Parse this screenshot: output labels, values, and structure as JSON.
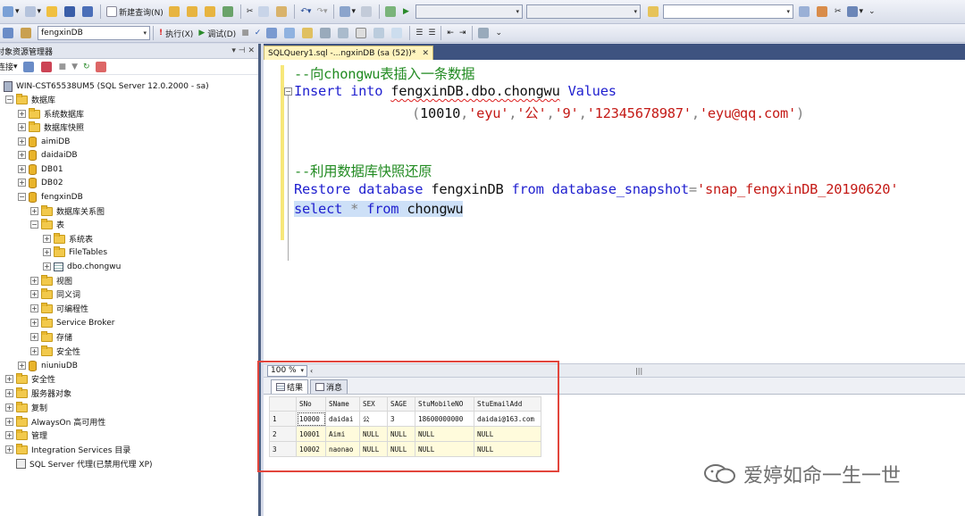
{
  "toolbar1": {
    "new_query_label": "新建查询(N)"
  },
  "toolbar2": {
    "database_selected": "fengxinDB",
    "execute_label": "执行(X)",
    "debug_label": "调试(D)"
  },
  "explorer": {
    "title": "对象资源管理器",
    "connect_label": "连接",
    "server": "WIN-CST65538UM5 (SQL Server 12.0.2000 - sa)",
    "nodes": {
      "databases": "数据库",
      "system_databases": "系统数据库",
      "snapshots": "数据库快照",
      "aimiDB": "aimiDB",
      "daidaiDB": "daidaiDB",
      "DB01": "DB01",
      "DB02": "DB02",
      "fengxinDB": "fengxinDB",
      "diagrams": "数据库关系图",
      "tables": "表",
      "system_tables": "系统表",
      "filetables": "FileTables",
      "chongwu": "dbo.chongwu",
      "views": "视图",
      "synonyms": "同义词",
      "programmability": "可编程性",
      "service_broker": "Service Broker",
      "storage": "存储",
      "security_db": "安全性",
      "niuniuDB": "niuniuDB",
      "security": "安全性",
      "server_objects": "服务器对象",
      "replication": "复制",
      "alwayson": "AlwaysOn 高可用性",
      "management": "管理",
      "integration": "Integration Services 目录",
      "agent": "SQL Server 代理(已禁用代理 XP)"
    }
  },
  "doc_tab": {
    "label": "SQLQuery1.sql -...ngxinDB (sa (52))*"
  },
  "code": {
    "l1": "--向chongwu表插入一条数据",
    "l2_kw1": "Insert",
    "l2_kw2": "into",
    "l2_obj": "fengxinDB.dbo.chongwu",
    "l2_kw3": "Values",
    "l3_open": "(",
    "l3_num": "10010",
    "l3_s1": "'eyu'",
    "l3_s2": "'公'",
    "l3_s3": "'9'",
    "l3_s4": "'12345678987'",
    "l3_s5": "'eyu@qq.com'",
    "l3_close": ")",
    "l4": "--利用数据库快照还原",
    "l5_kw1": "Restore",
    "l5_kw2": "database",
    "l5_obj": "fengxinDB",
    "l5_kw3": "from",
    "l5_kw4": "database_snapshot",
    "l5_eq": "=",
    "l5_str": "'snap_fengxinDB_20190620'",
    "l6_kw1": "select",
    "l6_star": "*",
    "l6_kw2": "from",
    "l6_obj": "chongwu"
  },
  "zoom": "100 %",
  "results": {
    "tab_results": "结果",
    "tab_messages": "消息",
    "columns": [
      "SNo",
      "SName",
      "SEX",
      "SAGE",
      "StuMobileNO",
      "StuEmailAdd"
    ],
    "rows": [
      [
        "1",
        "10000",
        "daidai",
        "公",
        "3",
        "18600000000",
        "daidai@163.com"
      ],
      [
        "2",
        "10001",
        "Aimi",
        "NULL",
        "NULL",
        "NULL",
        "NULL"
      ],
      [
        "3",
        "10002",
        "naonao",
        "NULL",
        "NULL",
        "NULL",
        "NULL"
      ]
    ]
  },
  "watermark": "爱婷如命一生一世",
  "colors": {
    "keyword": "#1f1fcf",
    "string": "#c41a16",
    "comment": "#228b22",
    "highlight_box": "#e2453c"
  }
}
